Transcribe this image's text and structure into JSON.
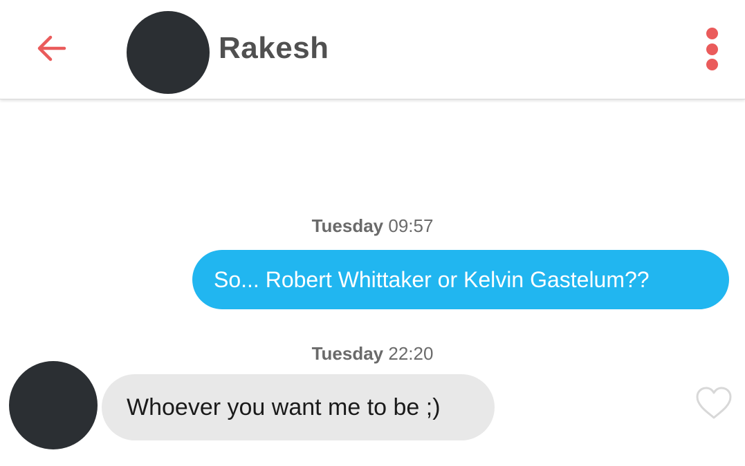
{
  "header": {
    "contact_name": "Rakesh",
    "back_icon": "arrow-left-icon",
    "menu_icon": "more-vertical-icon",
    "accent_color": "#ea5b5b"
  },
  "messages": [
    {
      "timestamp_day": "Tuesday",
      "timestamp_time": "09:57",
      "direction": "outgoing",
      "text": "So... Robert Whittaker or Kelvin Gastelum??",
      "bubble_color": "#21b6f0"
    },
    {
      "timestamp_day": "Tuesday",
      "timestamp_time": "22:20",
      "direction": "incoming",
      "text": "Whoever you want me to be ;)",
      "bubble_color": "#e8e8e8",
      "like_icon": "heart-outline-icon"
    }
  ]
}
